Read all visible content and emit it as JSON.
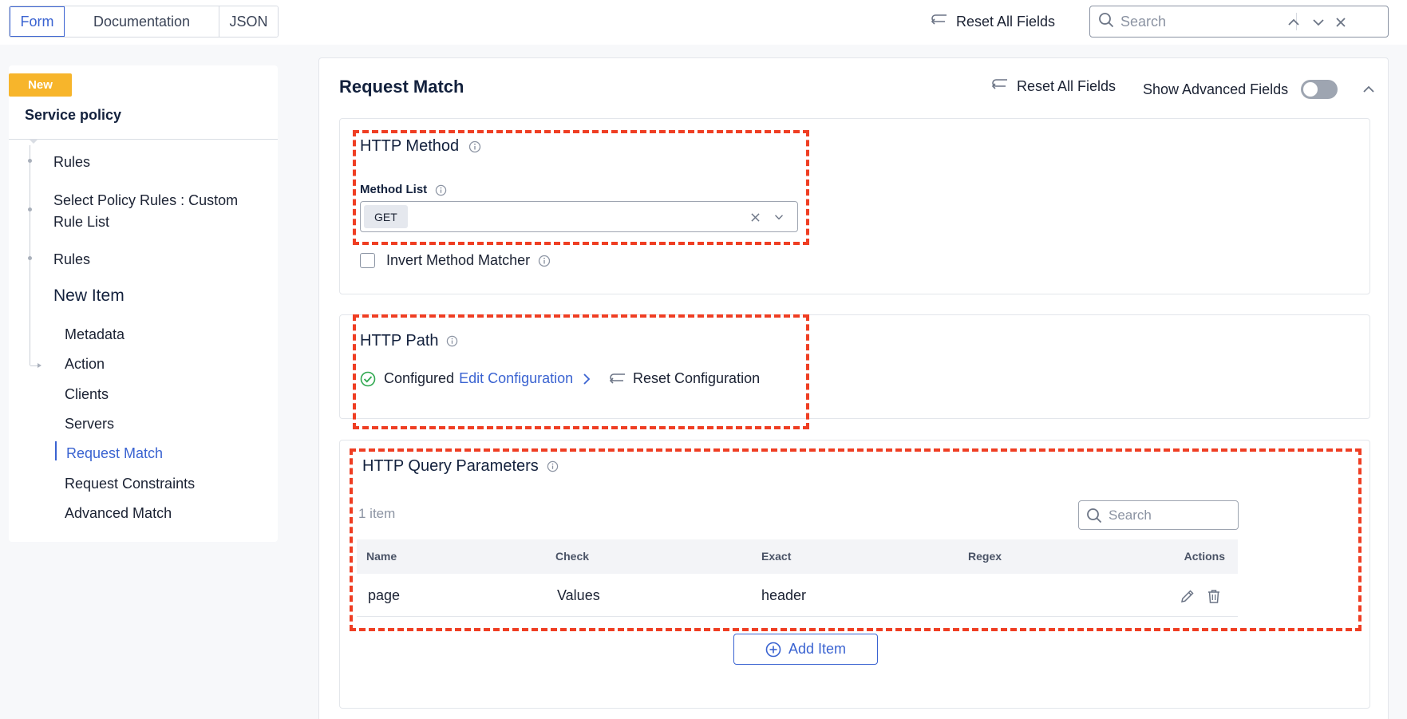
{
  "top_tabs": [
    "Form",
    "Documentation",
    "JSON"
  ],
  "top_bar": {
    "reset_all_label": "Reset All Fields",
    "search_placeholder": "Search"
  },
  "sidebar": {
    "badge": "New",
    "title": "Service policy",
    "tree_items": [
      "Rules",
      "Select Policy Rules : Custom Rule List",
      "Rules",
      "New Item"
    ],
    "sub_items": [
      "Metadata",
      "Action",
      "Clients",
      "Servers",
      "Request Match",
      "Request Constraints",
      "Advanced Match"
    ],
    "active_sub_item": "Request Match"
  },
  "main": {
    "title": "Request Match",
    "reset_all_label": "Reset All Fields",
    "advanced_fields_label": "Show Advanced Fields",
    "advanced_fields_enabled": false
  },
  "http_method": {
    "title": "HTTP Method",
    "method_list_label": "Method List",
    "selected_methods": [
      "GET"
    ],
    "invert_label": "Invert Method Matcher",
    "invert_checked": false
  },
  "http_path": {
    "title": "HTTP Path",
    "status": "Configured",
    "edit_link": "Edit Configuration",
    "reset_label": "Reset Configuration"
  },
  "http_query": {
    "title": "HTTP Query Parameters",
    "count_text": "1 item",
    "search_placeholder": "Search",
    "columns": [
      "Name",
      "Check",
      "Exact",
      "Regex",
      "Actions"
    ],
    "rows": [
      {
        "name": "page",
        "check": "Values",
        "exact": "header",
        "regex": ""
      }
    ],
    "add_label": "Add Item"
  },
  "colors": {
    "accent": "#3a63d1",
    "badge": "#f7b52b",
    "highlight": "#ef3e23",
    "success": "#2fa84f"
  }
}
